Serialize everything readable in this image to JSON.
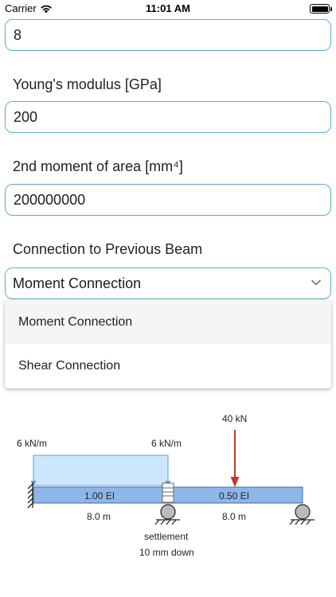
{
  "status": {
    "carrier": "Carrier",
    "time": "11:01 AM"
  },
  "fields": {
    "length_value": "8",
    "youngs_label": "Young's modulus [GPa]",
    "youngs_value": "200",
    "moment_label": "2nd moment of area [mm⁴]",
    "moment_value": "200000000"
  },
  "connection": {
    "label": "Connection to Previous Beam",
    "selected": "Moment Connection",
    "options": [
      "Moment Connection",
      "Shear Connection"
    ]
  },
  "diagram": {
    "left_load": "6 kN/m",
    "right_load": "6 kN/m",
    "point_load": "40 kN",
    "span1_stiffness": "1.00 EI",
    "span2_stiffness": "0.50 EI",
    "span1_length": "8.0 m",
    "span2_length": "8.0 m",
    "settlement_label": "settlement",
    "settlement_value": "10 mm down"
  },
  "colors": {
    "accent": "#5aaec8",
    "beam": "#8fb6e8",
    "dist_load": "#cce6fb",
    "point_load": "#c0392b"
  }
}
